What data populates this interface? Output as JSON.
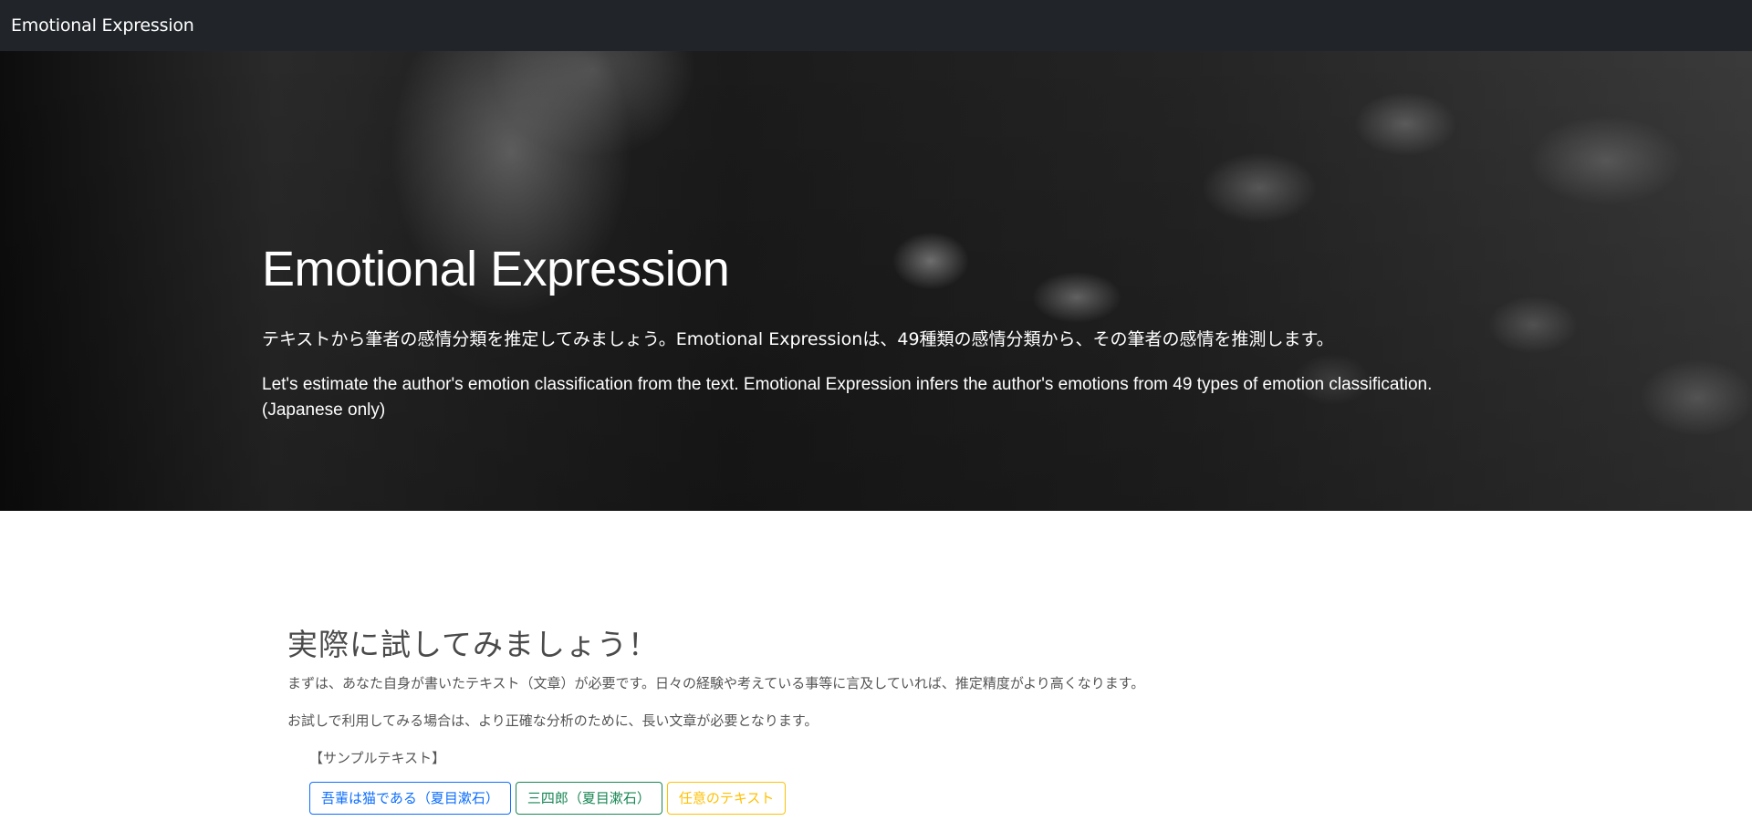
{
  "navbar": {
    "brand": "Emotional Expression"
  },
  "hero": {
    "title": "Emotional Expression",
    "lead_jp": "テキストから筆者の感情分類を推定してみましょう。Emotional Expressionは、49種類の感情分類から、その筆者の感情を推測します。",
    "lead_en": "Let's estimate the author's emotion classification from the text. Emotional Expression infers the author's emotions from 49 types of emotion classification. (Japanese only)"
  },
  "try_section": {
    "title": "実際に試してみましょう！",
    "paragraph1": "まずは、あなた自身が書いたテキスト（文章）が必要です。日々の経験や考えている事等に言及していれば、推定精度がより高くなります。",
    "paragraph2": "お試しで利用してみる場合は、より正確な分析のために、長い文章が必要となります。",
    "sample_label": "【サンプルテキスト】",
    "buttons": [
      {
        "label": "吾輩は猫である（夏目漱石）",
        "color": "#0d6efd"
      },
      {
        "label": "三四郎（夏目漱石）",
        "color": "#198754"
      },
      {
        "label": "任意のテキスト",
        "color": "#ffc107"
      }
    ]
  },
  "colors": {
    "navbar_bg": "#212529",
    "text_muted": "#555555"
  }
}
